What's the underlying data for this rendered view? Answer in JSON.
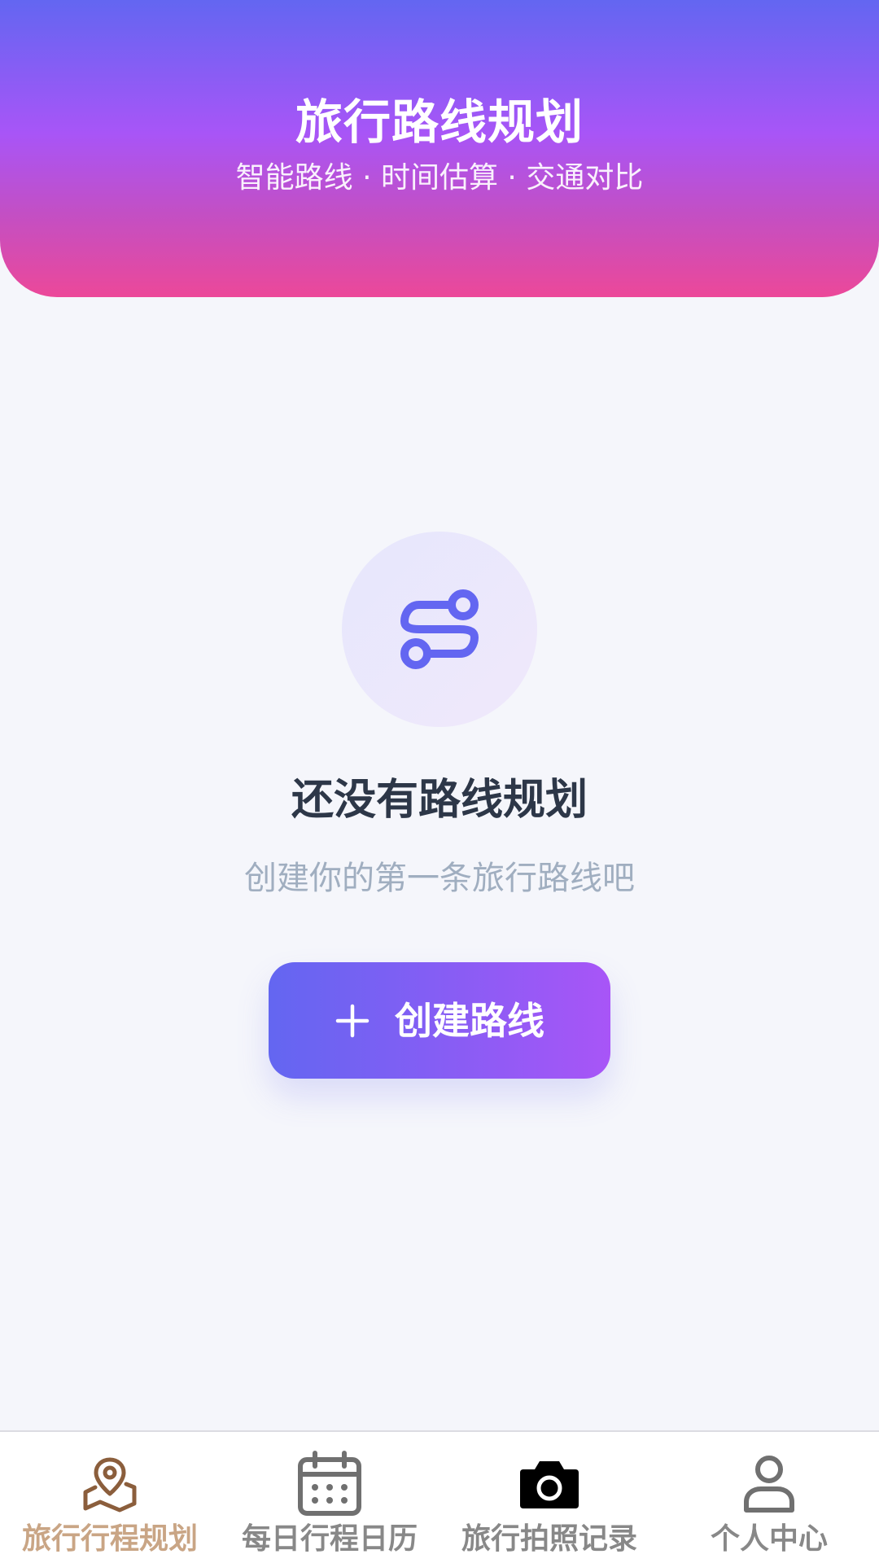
{
  "header": {
    "title": "旅行路线规划",
    "subtitle": "智能路线 · 时间估算 · 交通对比"
  },
  "empty_state": {
    "icon": "route-icon",
    "title": "还没有路线规划",
    "description": "创建你的第一条旅行路线吧",
    "button_label": "创建路线"
  },
  "tabbar": {
    "items": [
      {
        "label": "旅行行程规划",
        "icon": "map-pin-icon",
        "active": true
      },
      {
        "label": "每日行程日历",
        "icon": "calendar-icon",
        "active": false
      },
      {
        "label": "旅行拍照记录",
        "icon": "camera-icon",
        "active": false
      },
      {
        "label": "个人中心",
        "icon": "user-icon",
        "active": false
      }
    ]
  },
  "colors": {
    "accent": "#6366f1",
    "gradient_start": "#6366f1",
    "gradient_mid": "#a855f7",
    "gradient_end": "#ec4899",
    "active_tab": "#c9a585",
    "inactive_tab": "#888888",
    "title_text": "#2d3748",
    "muted_text": "#a0aec0"
  }
}
